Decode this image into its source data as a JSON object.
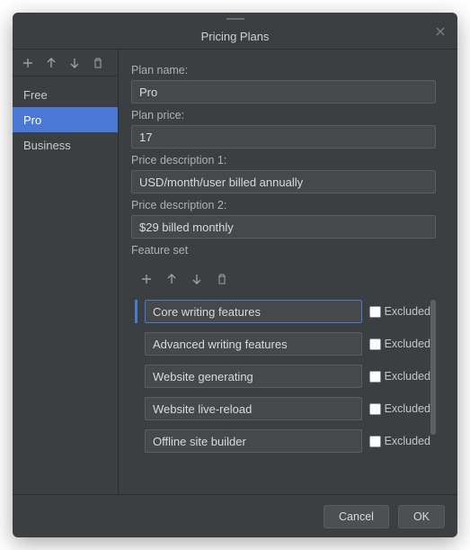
{
  "title": "Pricing Plans",
  "sidebar": {
    "items": [
      {
        "label": "Free",
        "selected": false
      },
      {
        "label": "Pro",
        "selected": true
      },
      {
        "label": "Business",
        "selected": false
      }
    ]
  },
  "form": {
    "plan_name_label": "Plan name:",
    "plan_name_value": "Pro",
    "plan_price_label": "Plan price:",
    "plan_price_value": "17",
    "price_desc1_label": "Price description 1:",
    "price_desc1_value": "USD/month/user billed annually",
    "price_desc2_label": "Price description 2:",
    "price_desc2_value": "$29 billed monthly",
    "feature_set_label": "Feature set"
  },
  "features": [
    {
      "name": "Core writing features",
      "excluded_label": "Excluded",
      "selected": true
    },
    {
      "name": "Advanced writing features",
      "excluded_label": "Excluded",
      "selected": false
    },
    {
      "name": "Website generating",
      "excluded_label": "Excluded",
      "selected": false
    },
    {
      "name": "Website live-reload",
      "excluded_label": "Excluded",
      "selected": false
    },
    {
      "name": "Offline site builder",
      "excluded_label": "Excluded",
      "selected": false
    }
  ],
  "footer": {
    "cancel": "Cancel",
    "ok": "OK"
  }
}
